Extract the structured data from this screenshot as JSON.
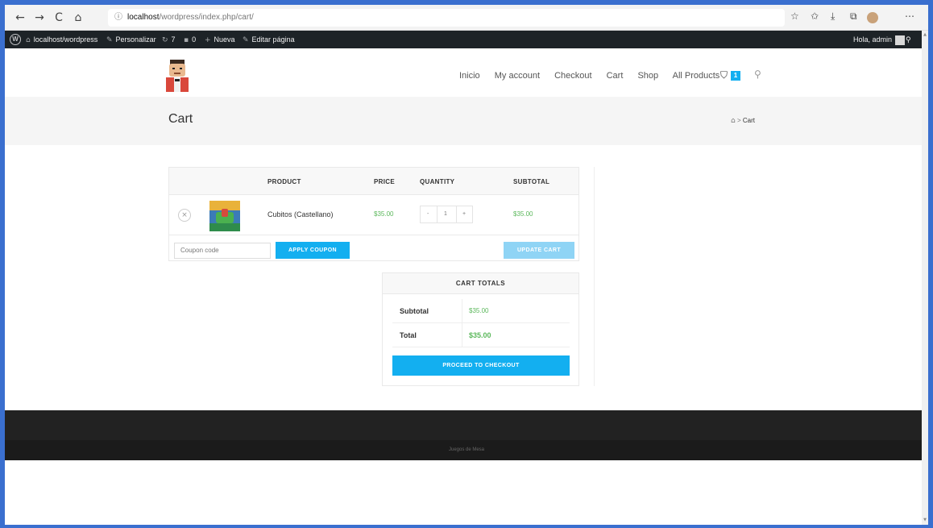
{
  "browser": {
    "back_icon": "←",
    "forward_icon": "→",
    "refresh_icon": "C",
    "home_icon": "⌂",
    "info_icon": "ⓘ",
    "url_host": "localhost",
    "url_path": "/wordpress/index.php/cart/",
    "toolbar_icons": [
      "☆",
      "✩",
      "⤓",
      "⧉",
      "⋯"
    ]
  },
  "adminbar": {
    "site": "localhost/wordpress",
    "customize": "Personalizar",
    "updates": "7",
    "comments": "0",
    "new": "Nueva",
    "edit": "Editar página",
    "greeting": "Hola, admin"
  },
  "header": {
    "menu": [
      "Inicio",
      "My account",
      "Checkout",
      "Cart",
      "Shop",
      "All Products"
    ],
    "cart_count": "1"
  },
  "page": {
    "title": "Cart",
    "breadcrumb_current": "Cart",
    "breadcrumb_sep": ">"
  },
  "cart": {
    "columns": [
      "PRODUCT",
      "PRICE",
      "QUANTITY",
      "SUBTOTAL"
    ],
    "items": [
      {
        "name": "Cubitos (Castellano)",
        "price": "$35.00",
        "quantity": "1",
        "subtotal": "$35.00"
      }
    ],
    "qty_minus": "-",
    "qty_plus": "+",
    "remove_icon": "×",
    "coupon_placeholder": "Coupon code",
    "apply_label": "APPLY COUPON",
    "update_label": "UPDATE CART"
  },
  "totals": {
    "heading": "CART TOTALS",
    "subtotal_label": "Subtotal",
    "subtotal_value": "$35.00",
    "total_label": "Total",
    "total_value": "$35.00",
    "checkout_label": "PROCEED TO CHECKOUT"
  },
  "footer": {
    "copyright": "Juegos de Mesa"
  },
  "colors": {
    "accent": "#13aff0",
    "price_green": "#5cb85c",
    "adminbar": "#1d2327",
    "footer": "#222222"
  }
}
